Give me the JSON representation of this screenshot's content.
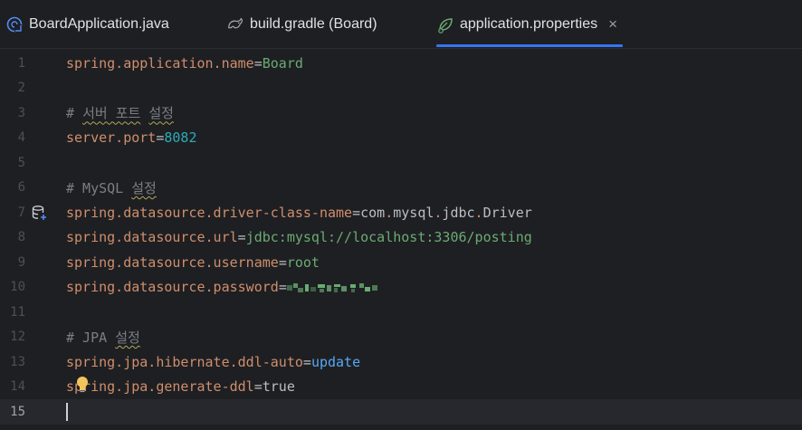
{
  "tabs": [
    {
      "label": "BoardApplication.java",
      "icon": "java-class-icon",
      "active": false
    },
    {
      "label": "build.gradle (Board)",
      "icon": "gradle-icon",
      "active": false
    },
    {
      "label": "application.properties",
      "icon": "spring-leaf-icon",
      "active": true
    }
  ],
  "close_glyph": "×",
  "accent": "#3574f0",
  "editor": {
    "current_line": "15",
    "lines": [
      {
        "n": "1",
        "key": "spring.application.name",
        "eq": "=",
        "val": "Board"
      },
      {
        "n": "2"
      },
      {
        "n": "3",
        "comment_prefix": "# ",
        "comment_word1": "서버 포트",
        "comment_sep": " ",
        "comment_word2": "설정"
      },
      {
        "n": "4",
        "key": "server.port",
        "eq": "=",
        "val": "8082"
      },
      {
        "n": "5"
      },
      {
        "n": "6",
        "comment_prefix": "# MySQL ",
        "comment_word2": "설정"
      },
      {
        "n": "7",
        "key": "spring.datasource.driver-class-name",
        "eq": "=",
        "val_parts": [
          "com",
          ".",
          "mysql",
          ".",
          "jdbc",
          ".",
          "Driver"
        ]
      },
      {
        "n": "8",
        "key": "spring.datasource.url",
        "eq": "=",
        "val": "jdbc:mysql://localhost:3306/posting"
      },
      {
        "n": "9",
        "key": "spring.datasource.username",
        "eq": "=",
        "val": "root"
      },
      {
        "n": "10",
        "key": "spring.datasource.password",
        "eq": "="
      },
      {
        "n": "11"
      },
      {
        "n": "12",
        "comment_prefix": "# JPA ",
        "comment_word2": "설정"
      },
      {
        "n": "13",
        "key": "spring.jpa.hibernate.ddl-auto",
        "eq": "=",
        "val": "update"
      },
      {
        "n": "14",
        "key": "spring.jpa.generate-ddl",
        "eq": "=",
        "val": "true"
      },
      {
        "n": "15"
      }
    ]
  }
}
